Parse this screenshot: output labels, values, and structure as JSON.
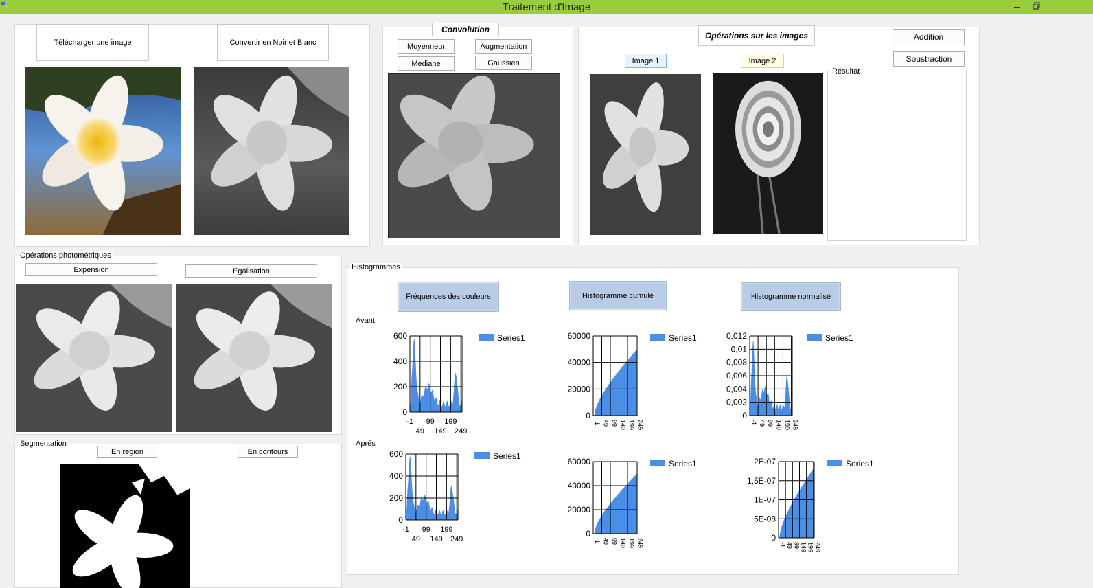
{
  "window": {
    "title": "Traitement d'Image"
  },
  "load": {
    "upload_label": "Télécharger une image",
    "bw_label": "Convertir en Noir et Blanc"
  },
  "convolution": {
    "title": "Convolution",
    "moyenneur": "Moyenneur",
    "augmentation": "Augmentation",
    "mediane": "Mediane",
    "gaussien": "Gaussien"
  },
  "ops": {
    "title": "Opérations sur les images",
    "image1": "Image 1",
    "image2": "Image 2",
    "addition": "Addition",
    "soustraction": "Soustraction",
    "result_label": "Résultat"
  },
  "photometric": {
    "title": "Opérations photométriques",
    "expension": "Expension",
    "egalisation": "Egalisation"
  },
  "segmentation": {
    "title": "Segmentation",
    "region": "En region",
    "contours": "En contours"
  },
  "histograms": {
    "title": "Histogrammes",
    "freq_button": "Fréquences des couleurs",
    "cumul_button": "Histogramme cumulé",
    "norm_button": "Histogramme normalisé",
    "before_label": "Avant",
    "after_label": "Aprés"
  },
  "chart_data": [
    {
      "type": "area",
      "title": "",
      "row": "Avant",
      "legend": "Series1",
      "x_ticks": [
        "-1",
        "49",
        "99",
        "149",
        "199",
        "249"
      ],
      "y_ticks": [
        "0",
        "200",
        "400",
        "600"
      ],
      "ylim": [
        0,
        600
      ],
      "shape": "freq",
      "peak": 560
    },
    {
      "type": "area",
      "title": "",
      "row": "Avant",
      "legend": "Series1",
      "x_ticks": [
        "-1",
        "49",
        "99",
        "149",
        "199",
        "249"
      ],
      "y_ticks": [
        "0",
        "20000",
        "40000",
        "60000"
      ],
      "ylim": [
        0,
        60000
      ],
      "shape": "cumul",
      "final": 50000
    },
    {
      "type": "area",
      "title": "",
      "row": "Avant",
      "legend": "Series1",
      "x_ticks": [
        "-1",
        "49",
        "99",
        "149",
        "199",
        "249"
      ],
      "y_ticks": [
        "0",
        "0,002",
        "0,004",
        "0,006",
        "0,008",
        "0,01",
        "0,012"
      ],
      "ylim": [
        0,
        0.012
      ],
      "shape": "freq",
      "peak": 0.011
    },
    {
      "type": "area",
      "title": "",
      "row": "Aprés",
      "legend": "Series1",
      "x_ticks": [
        "-1",
        "49",
        "99",
        "149",
        "199",
        "249"
      ],
      "y_ticks": [
        "0",
        "200",
        "400",
        "600"
      ],
      "ylim": [
        0,
        600
      ],
      "shape": "freq",
      "peak": 560
    },
    {
      "type": "area",
      "title": "",
      "row": "Aprés",
      "legend": "Series1",
      "x_ticks": [
        "-1",
        "49",
        "99",
        "149",
        "199",
        "249"
      ],
      "y_ticks": [
        "0",
        "20000",
        "40000",
        "60000"
      ],
      "ylim": [
        0,
        60000
      ],
      "shape": "cumul",
      "final": 50000
    },
    {
      "type": "area",
      "title": "",
      "row": "Aprés",
      "legend": "Series1",
      "x_ticks": [
        "-1",
        "49",
        "99",
        "149",
        "199",
        "249"
      ],
      "y_ticks": [
        "0",
        "5E-08",
        "1E-07",
        "1,5E-07",
        "2E-07"
      ],
      "ylim": [
        0,
        2e-07
      ],
      "shape": "cumul",
      "final": 1.85e-07
    }
  ],
  "colors": {
    "titlebar": "#9acd3b",
    "series": "#4a8ee6",
    "button_blue": "#b8cce6"
  }
}
